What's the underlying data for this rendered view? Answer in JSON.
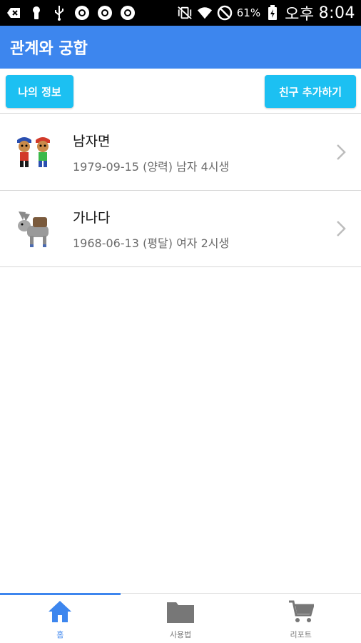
{
  "status_bar": {
    "battery": "61%",
    "ampm": "오후",
    "time": "8:04",
    "icons": [
      "back-icon",
      "keyhole-icon",
      "usb-icon",
      "chrome-icon",
      "chrome-icon",
      "chrome-icon",
      "vibrate-mute-icon",
      "wifi-icon",
      "no-sim-icon",
      "battery-charging-icon"
    ]
  },
  "app_bar": {
    "title": "관계와 궁합",
    "color": "#3d86ee"
  },
  "toolbar": {
    "my_info_label": "나의 정보",
    "add_friend_label": "친구 추가하기",
    "button_color": "#1cc0f2"
  },
  "people": [
    {
      "name": "남자면",
      "detail": "1979-09-15 (양력) 남자 4시생",
      "avatar": "couple-kids-avatar"
    },
    {
      "name": "가나다",
      "detail": "1968-06-13 (평달) 여자 2시생",
      "avatar": "donkey-avatar"
    }
  ],
  "tabs": [
    {
      "label": "홈",
      "icon": "home-icon",
      "active": true
    },
    {
      "label": "사용법",
      "icon": "folder-icon",
      "active": false
    },
    {
      "label": "리포트",
      "icon": "cart-icon",
      "active": false
    }
  ]
}
